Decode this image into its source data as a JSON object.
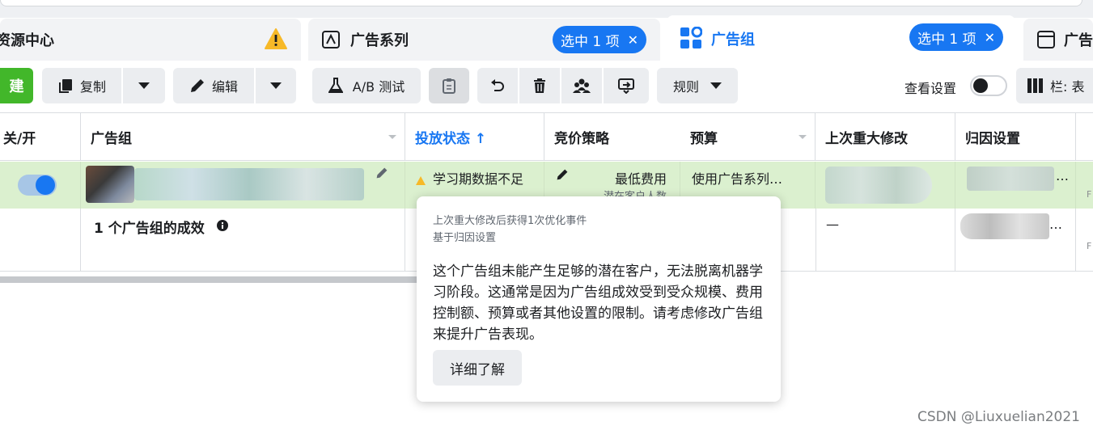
{
  "tabs": {
    "resource_center": {
      "title": "资源中心"
    },
    "campaigns": {
      "title": "广告系列",
      "selected": "选中 1 项"
    },
    "ad_sets": {
      "title": "广告组",
      "selected": "选中 1 项"
    },
    "ads": {
      "title": "广告"
    }
  },
  "toolbar": {
    "create_label": "建",
    "copy_label": "复制",
    "edit_label": "编辑",
    "ab_test_label": "A/B 测试",
    "rules_label": "规则",
    "view_settings_label": "查看设置",
    "columns_label": "栏: 表"
  },
  "table": {
    "headers": {
      "toggle": "关/开",
      "adset": "广告组",
      "delivery": "投放状态 ↑",
      "bid_strategy": "竞价策略",
      "budget": "预算",
      "last_edit": "上次重大修改",
      "attribution": "归因设置"
    },
    "row": {
      "delivery_status": "学习期数据不足",
      "bid_strategy": "最低费用",
      "bid_sub": "潜在客户人数",
      "budget": "使用广告系列…",
      "attribution_more": "…"
    },
    "summary": {
      "title": "1 个广告组的成效",
      "last_edit": "—",
      "attribution_more": "…"
    }
  },
  "popover": {
    "meta_line1": "上次重大修改后获得1次优化事件",
    "meta_line2": "基于归因设置",
    "body": "这个广告组未能产生足够的潜在客户，无法脱离机器学习阶段。这通常是因为广告组成效受到受众规模、费用控制额、预算或者其他设置的限制。请考虑修改广告组来提升广告表现。",
    "learn_more": "详细了解"
  },
  "watermark": "CSDN @Liuxuelian2021",
  "colors": {
    "accent": "#1877f2",
    "create": "#42b72a",
    "row_highlight": "#dbf0cf",
    "warning": "#f7b928"
  }
}
